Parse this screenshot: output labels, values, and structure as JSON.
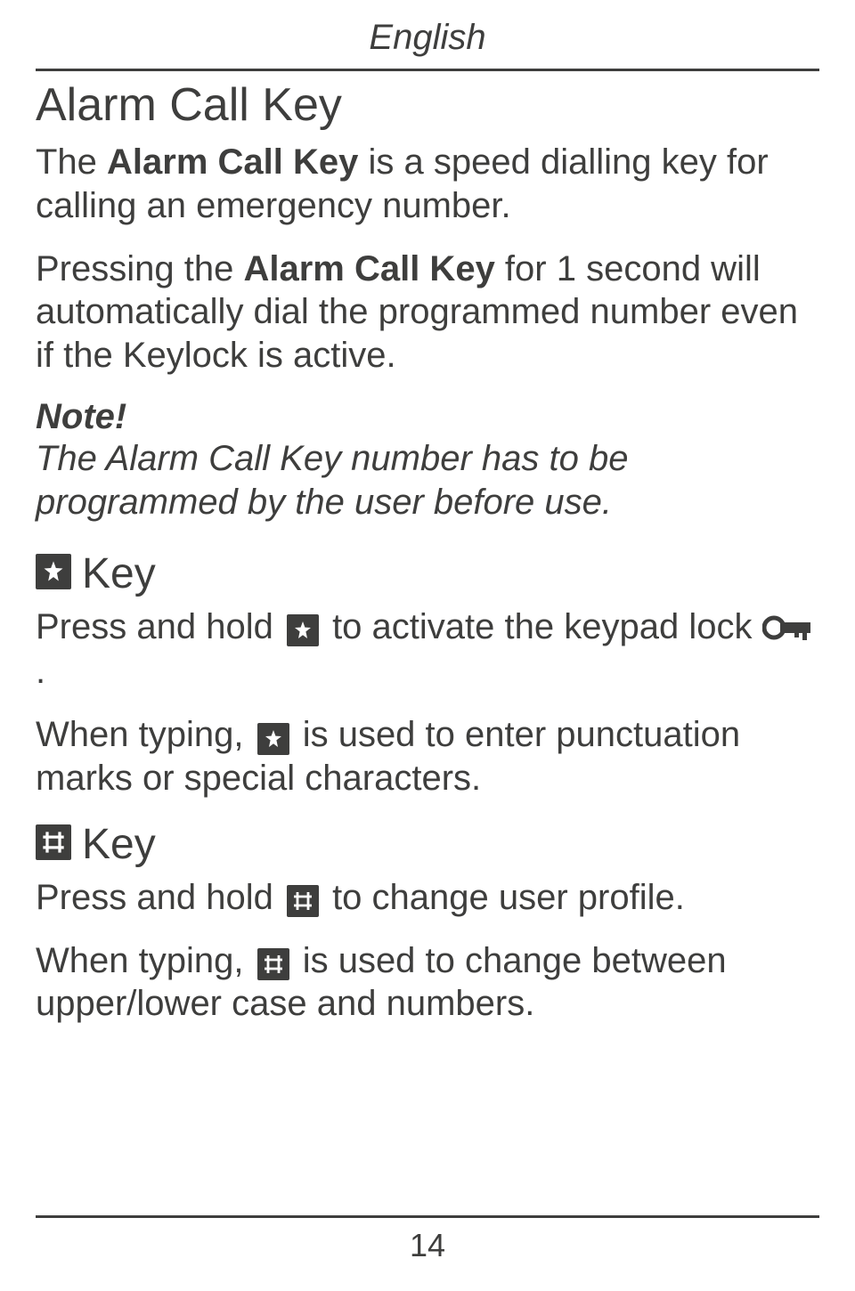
{
  "header": {
    "language": "English"
  },
  "section1": {
    "title": "Alarm Call Key",
    "p1_pre": "The ",
    "p1_bold": "Alarm Call Key",
    "p1_post": " is a speed dialling key for calling an emergency number.",
    "p2_pre": "Pressing the ",
    "p2_bold": "Alarm Call Key",
    "p2_post": " for 1 second will automatically dial the programmed number even if the Keylock is active.",
    "note_label": "Note!",
    "note_body": "The Alarm Call Key number has to be programmed by the user before use."
  },
  "section2": {
    "title_text": " Key",
    "p1_a": "Press and hold ",
    "p1_b": " to activate the keypad lock ",
    "p1_c": ".",
    "p2_a": "When typing, ",
    "p2_b": " is used to enter punctuation marks or special characters."
  },
  "section3": {
    "title_text": " Key",
    "p1_a": "Press and hold ",
    "p1_b": " to change user profile.",
    "p2_a": "When typing, ",
    "p2_b": " is used to change between upper/lower case and numbers."
  },
  "footer": {
    "page": "14"
  }
}
